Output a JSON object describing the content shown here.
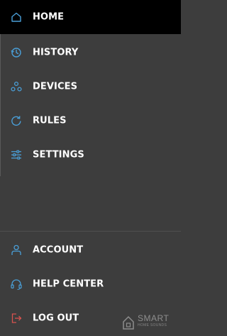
{
  "menu": {
    "items": [
      {
        "label": "HOME",
        "icon": "home-icon",
        "active": true
      },
      {
        "label": "HISTORY",
        "icon": "history-icon",
        "active": false
      },
      {
        "label": "DEVICES",
        "icon": "devices-icon",
        "active": false
      },
      {
        "label": "RULES",
        "icon": "rules-icon",
        "active": false
      },
      {
        "label": "SETTINGS",
        "icon": "settings-icon",
        "active": false
      }
    ],
    "bottom_items": [
      {
        "label": "ACCOUNT",
        "icon": "account-icon"
      },
      {
        "label": "HELP CENTER",
        "icon": "help-center-icon"
      },
      {
        "label": "LOG OUT",
        "icon": "logout-icon"
      }
    ]
  },
  "watermark": {
    "line1": "SMART",
    "line2": "HOME SOUNDS"
  },
  "colors": {
    "background": "#3d3d3d",
    "active_background": "#000000",
    "accent_blue": "#4a9fd8",
    "logout_red": "#d9534f",
    "text": "#ffffff"
  }
}
